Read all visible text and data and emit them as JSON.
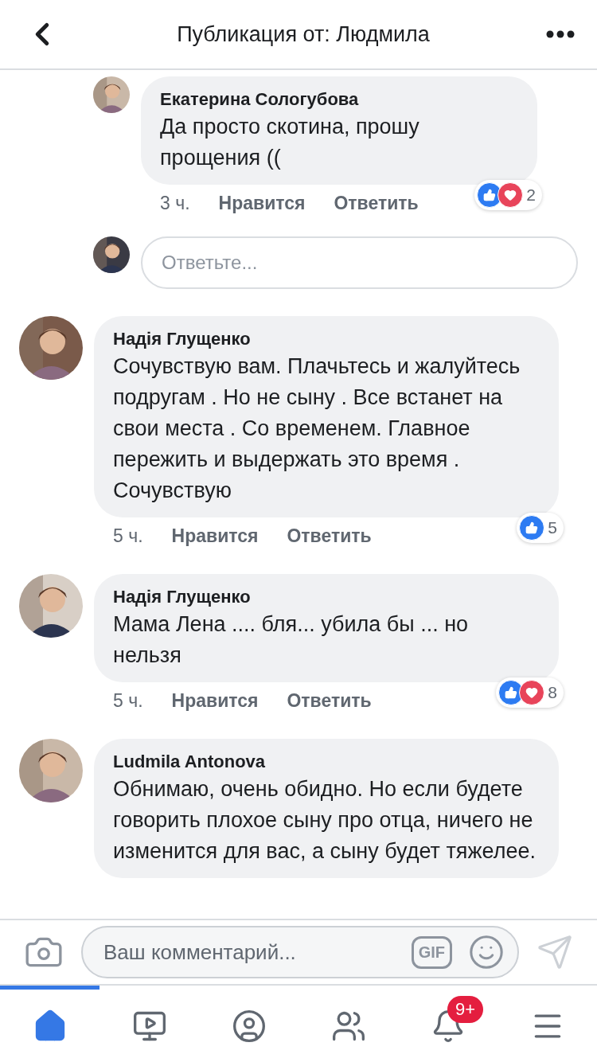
{
  "header": {
    "title": "Публикация от: Людмила"
  },
  "comments": [
    {
      "kind": "reply",
      "author": "Екатерина Сологубова",
      "text": "Да просто скотина, прошу прощения ((",
      "time": "3 ч.",
      "like": "Нравится",
      "answer": "Ответить",
      "like_reaction": true,
      "love_reaction": true,
      "count": "2"
    },
    {
      "kind": "reply_field",
      "placeholder": "Ответьте..."
    },
    {
      "kind": "comment",
      "author": "Надія Глущенко",
      "text": "Сочувствую вам. Плачьтесь и жалуйтесь подругам . Но не сыну . Все встанет на свои места . Со временем. Главное пережить и выдержать это время . Сочувствую",
      "time": "5 ч.",
      "like": "Нравится",
      "answer": "Ответить",
      "like_reaction": true,
      "count": "5"
    },
    {
      "kind": "comment",
      "author": "Надія Глущенко",
      "text": "Мама Лена .... бля... убила бы ... но нельзя",
      "time": "5 ч.",
      "like": "Нравится",
      "answer": "Ответить",
      "like_reaction": true,
      "love_reaction": true,
      "count": "8"
    },
    {
      "kind": "comment",
      "author": "Ludmila Antonova",
      "text": "Обнимаю, очень обидно. Но если будете говорить плохое сыну про отца, ничего не изменится для вас, а сыну будет тяжелее."
    }
  ],
  "composer": {
    "placeholder": "Ваш комментарий...",
    "gif": "GIF"
  },
  "tabs": [
    {
      "selected": true
    },
    {
      "selected": false
    },
    {
      "selected": false
    },
    {
      "selected": false
    },
    {
      "selected": false,
      "badge": "9+"
    },
    {
      "selected": false
    }
  ]
}
